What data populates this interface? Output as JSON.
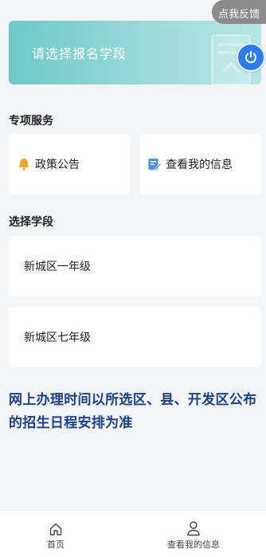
{
  "feedback": {
    "label": "点我反馈"
  },
  "banner": {
    "text": "请选择报名学段"
  },
  "services": {
    "title": "专项服务",
    "items": [
      {
        "label": "政策公告",
        "icon": "bell-icon"
      },
      {
        "label": "查看我的信息",
        "icon": "edit-note-icon"
      }
    ]
  },
  "grades": {
    "title": "选择学段",
    "items": [
      {
        "label": "新城区一年级"
      },
      {
        "label": "新城区七年级"
      }
    ]
  },
  "notice": {
    "text": "网上办理时间以所选区、县、开发区公布的招生日程安排为准"
  },
  "tabbar": {
    "items": [
      {
        "label": "首页",
        "icon": "home-icon"
      },
      {
        "label": "查看我的信息",
        "icon": "user-icon"
      }
    ]
  },
  "colors": {
    "banner": "#6dc9c7",
    "accent": "#2f7cf0",
    "notice": "#1c3f86",
    "bell": "#f3a52b"
  }
}
